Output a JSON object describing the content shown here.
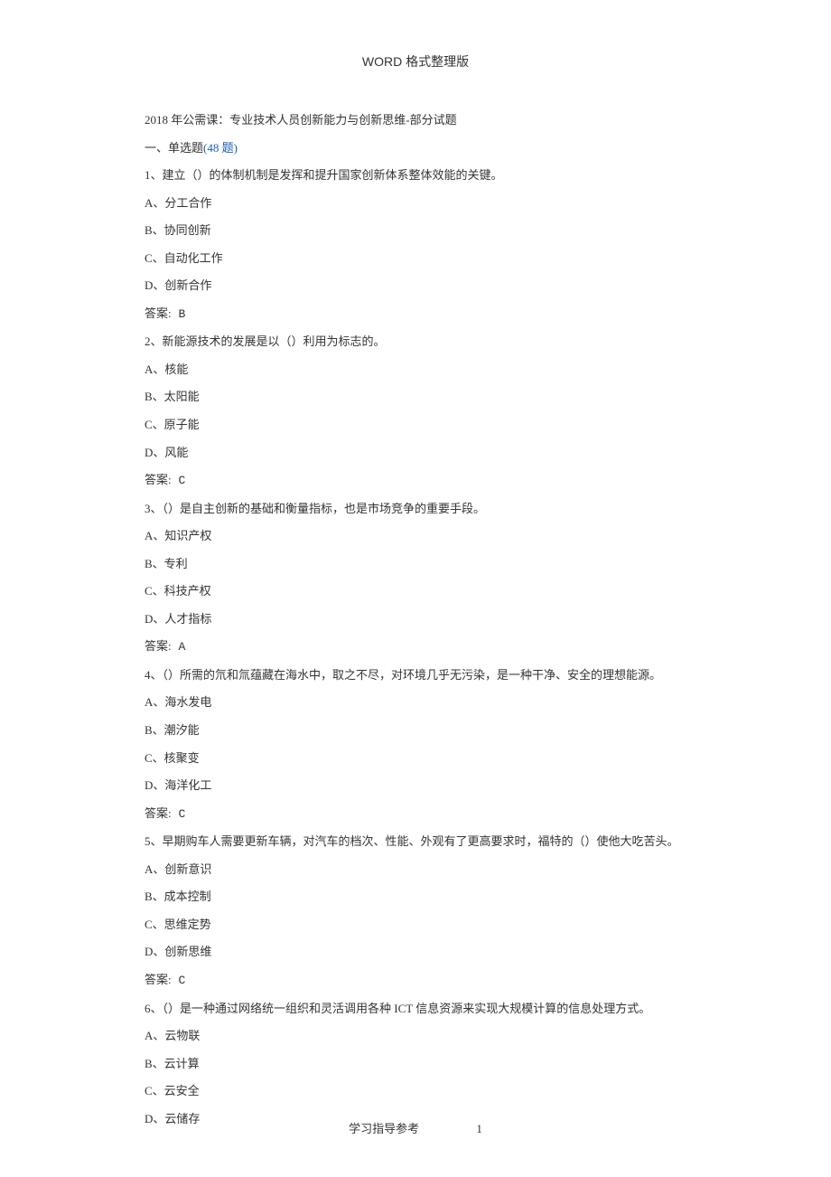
{
  "header": "WORD 格式整理版",
  "title": "2018 年公需课：专业技术人员创新能力与创新思维-部分试题",
  "section": {
    "label": "一、单选题",
    "count_text": "(48 题)"
  },
  "answer_label_prefix": "答案:",
  "questions": [
    {
      "stem": "1、建立（）的体制机制是发挥和提升国家创新体系整体效能的关键。",
      "options": [
        "A、分工合作",
        "B、协同创新",
        "C、自动化工作",
        "D、创新合作"
      ],
      "answer": "B"
    },
    {
      "stem": "2、新能源技术的发展是以（）利用为标志的。",
      "options": [
        "A、核能",
        "B、太阳能",
        "C、原子能",
        "D、风能"
      ],
      "answer": "C"
    },
    {
      "stem": "3、（）是自主创新的基础和衡量指标，也是市场竞争的重要手段。",
      "options": [
        "A、知识产权",
        "B、专利",
        "C、科技产权",
        "D、人才指标"
      ],
      "answer": "A"
    },
    {
      "stem": "4、（）所需的氘和氚蕴藏在海水中，取之不尽，对环境几乎无污染，是一种干净、安全的理想能源。",
      "options": [
        "A、海水发电",
        "B、潮汐能",
        "C、核聚变",
        "D、海洋化工"
      ],
      "answer": "C"
    },
    {
      "stem": "5、早期购车人需要更新车辆，对汽车的档次、性能、外观有了更高要求时，福特的（）使他大吃苦头。",
      "options": [
        "A、创新意识",
        "B、成本控制",
        "C、思维定势",
        "D、创新思维"
      ],
      "answer": "C"
    },
    {
      "stem": "6、（）是一种通过网络统一组织和灵活调用各种 ICT 信息资源来实现大规模计算的信息处理方式。",
      "options": [
        "A、云物联",
        "B、云计算",
        "C、云安全",
        "D、云储存"
      ],
      "answer": null
    }
  ],
  "footer": {
    "text": "学习指导参考",
    "page": "1"
  }
}
